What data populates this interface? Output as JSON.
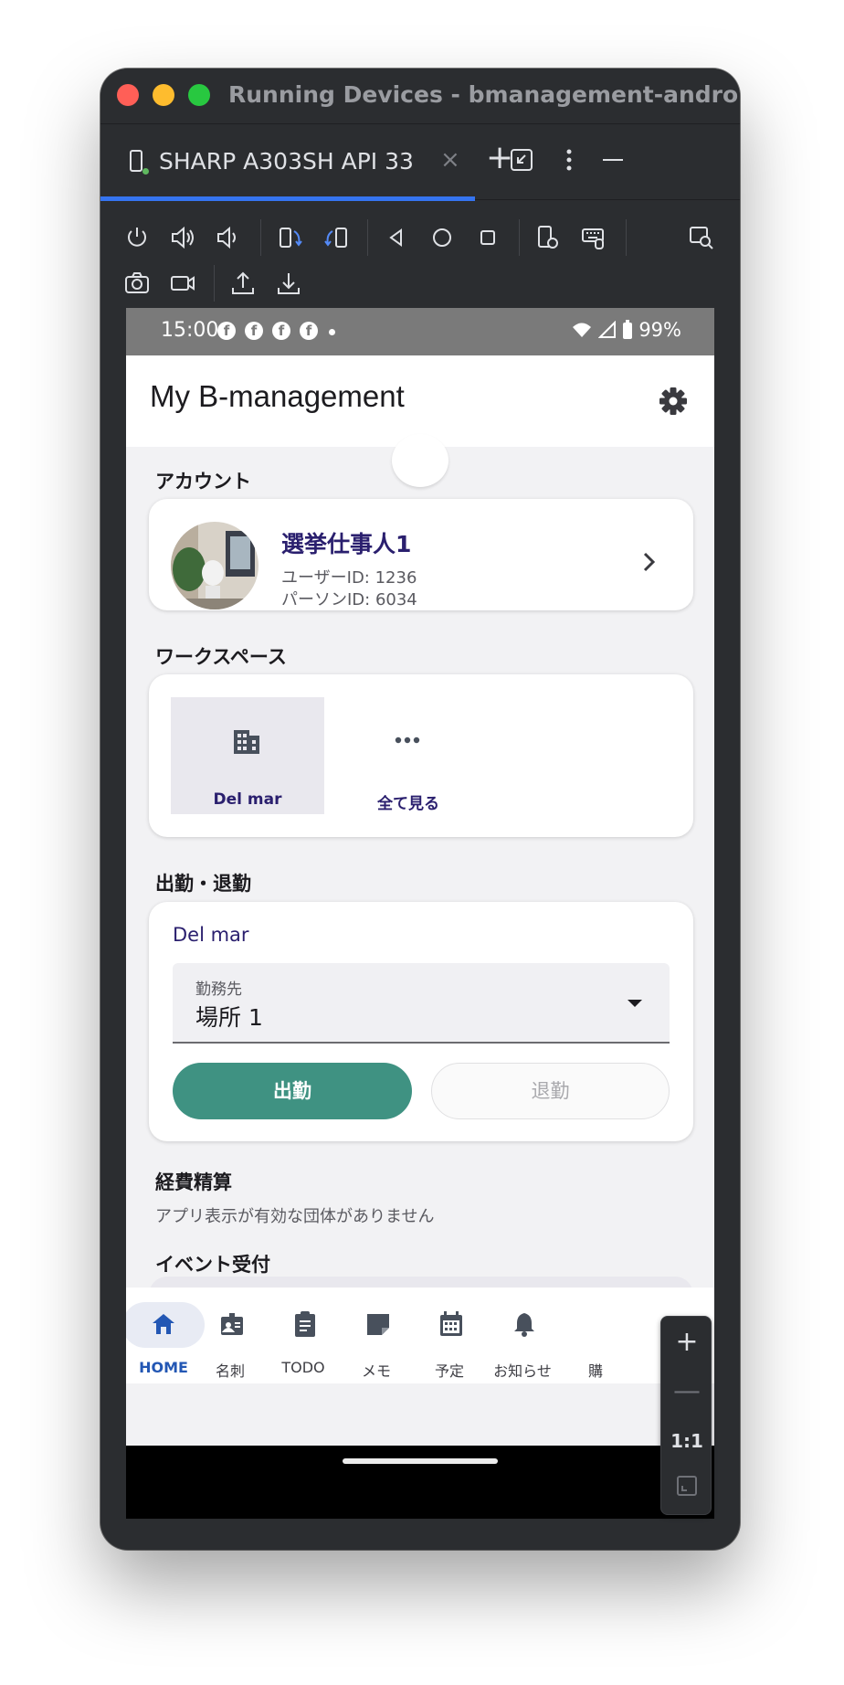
{
  "window": {
    "title": "Running Devices - bmanagement-android"
  },
  "tab": {
    "label": "SHARP A303SH API 33",
    "close": "×",
    "add": "+"
  },
  "toolbar": {
    "icons": [
      "power-icon",
      "volume-up-icon",
      "volume-down-icon",
      "rotate-left-icon",
      "rotate-right-icon",
      "back-icon",
      "home-icon",
      "overview-icon",
      "device-settings-icon",
      "keyboard-icon",
      "inspect-icon",
      "screenshot-icon",
      "screen-record-icon",
      "upload-icon",
      "download-icon"
    ]
  },
  "status_bar": {
    "time": "15:00",
    "battery": "99%",
    "fb": "f"
  },
  "app": {
    "title": "My B-management",
    "account": {
      "section_title": "アカウント",
      "name": "選挙仕事人1",
      "user_id": "ユーザーID: 1236",
      "person_id": "パーソンID: 6034"
    },
    "workspace": {
      "section_title": "ワークスペース",
      "tiles": [
        {
          "label": "Del mar",
          "icon": "building-icon",
          "selected": true
        },
        {
          "label": "全て見る",
          "icon": "more-icon",
          "selected": false
        }
      ]
    },
    "attendance": {
      "section_title": "出勤・退勤",
      "workspace_name": "Del mar",
      "field_label": "勤務先",
      "field_value": "場所 1",
      "clock_in": "出勤",
      "clock_out": "退勤"
    },
    "expense": {
      "section_title": "経費精算",
      "message": "アプリ表示が有効な団体がありません"
    },
    "event": {
      "section_title": "イベント受付"
    },
    "nav": [
      {
        "label": "HOME",
        "icon": "home-icon",
        "active": true
      },
      {
        "label": "名刺",
        "icon": "business-card-icon",
        "active": false
      },
      {
        "label": "TODO",
        "icon": "clipboard-icon",
        "active": false
      },
      {
        "label": "メモ",
        "icon": "memo-icon",
        "active": false
      },
      {
        "label": "予定",
        "icon": "calendar-icon",
        "active": false
      },
      {
        "label": "お知らせ",
        "icon": "bell-icon",
        "active": false
      },
      {
        "label": "購",
        "icon": "cart-icon",
        "active": false
      }
    ]
  },
  "zoom": {
    "plus": "+",
    "minus": "—",
    "one_to_one": "1:1"
  },
  "colors": {
    "accent": "#3574f0",
    "primary_button": "#3f9282",
    "nav_active": "#2357b4",
    "workspace_text": "#2a1f6e"
  }
}
